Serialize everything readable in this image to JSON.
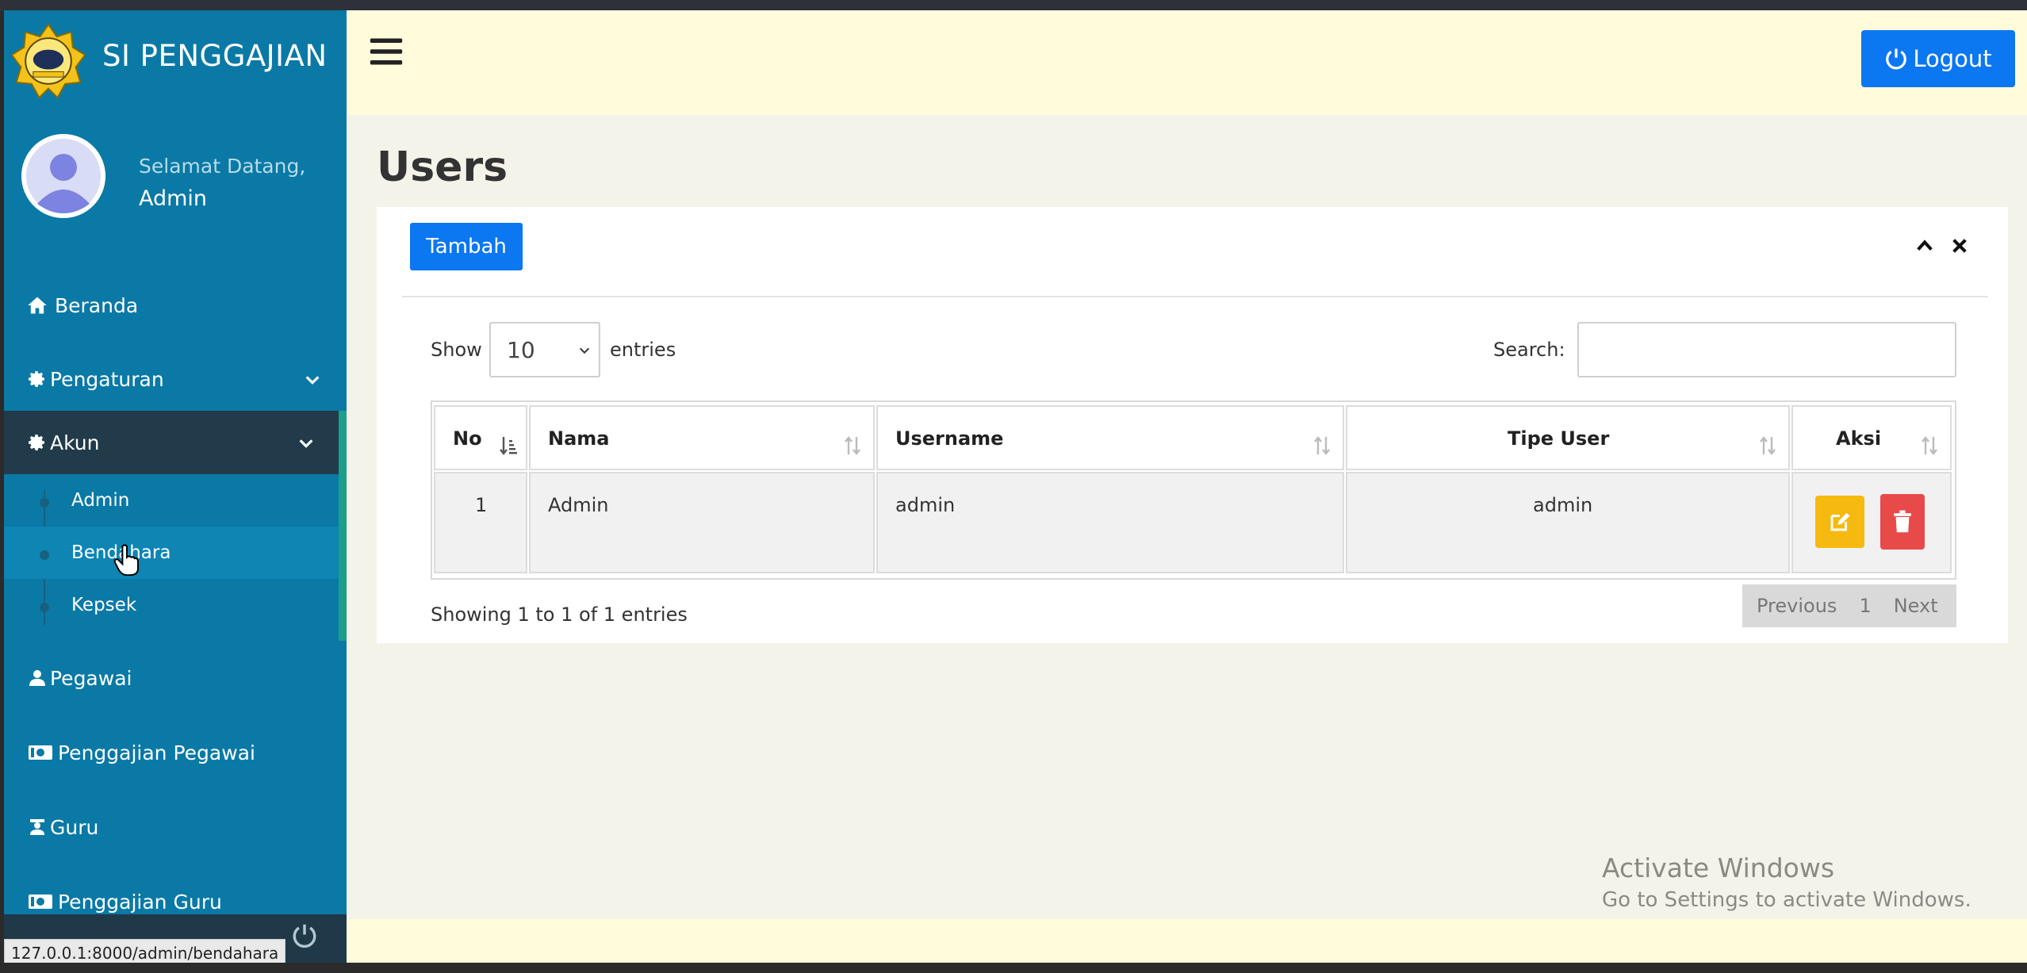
{
  "app": {
    "title": "SI PENGGAJIAN",
    "logout_label": "Logout"
  },
  "user_panel": {
    "greeting": "Selamat Datang,",
    "name": "Admin"
  },
  "sidebar": {
    "items": [
      {
        "label": "Beranda",
        "icon": "home-icon"
      },
      {
        "label": "Pengaturan",
        "icon": "gear-icon"
      },
      {
        "label": "Akun",
        "icon": "gear-icon"
      },
      {
        "label": "Pegawai",
        "icon": "user-icon"
      },
      {
        "label": "Penggajian Pegawai",
        "icon": "money-icon"
      },
      {
        "label": "Guru",
        "icon": "teacher-icon"
      },
      {
        "label": "Penggajian Guru",
        "icon": "money-icon"
      }
    ],
    "akun_submenu": [
      "Admin",
      "Bendahara",
      "Kepsek"
    ]
  },
  "page": {
    "title": "Users",
    "add_label": "Tambah"
  },
  "table_controls": {
    "show_label": "Show",
    "page_size": "10",
    "entries_label": "entries",
    "search_label": "Search:"
  },
  "table": {
    "headers": [
      "No",
      "Nama",
      "Username",
      "Tipe User",
      "Aksi"
    ],
    "rows": [
      {
        "no": "1",
        "nama": "Admin",
        "username": "admin",
        "tipe": "admin"
      }
    ]
  },
  "footer": {
    "info": "Showing 1 to 1 of 1 entries",
    "previous": "Previous",
    "page": "1",
    "next": "Next"
  },
  "status_url": "127.0.0.1:8000/admin/bendahara",
  "watermark": {
    "line1": "Activate Windows",
    "line2": "Go to Settings to activate Windows."
  },
  "colors": {
    "sidebar": "#0a79a6",
    "active": "#213b4a",
    "primary": "#0b77f0",
    "warning": "#f6b90f",
    "danger": "#e84949",
    "topbar": "#fffbdb"
  }
}
